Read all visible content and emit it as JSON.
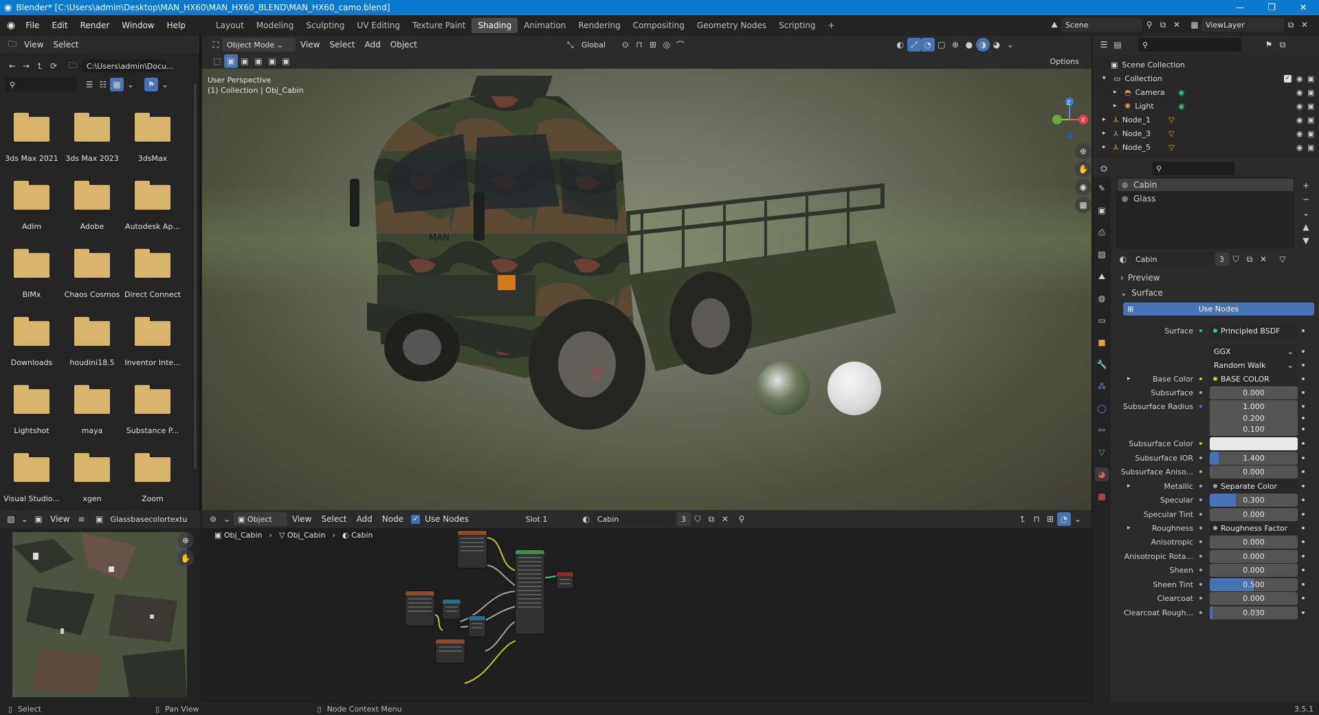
{
  "window": {
    "title": "Blender* [C:\\Users\\admin\\Desktop\\MAN_HX60\\MAN_HX60_BLEND\\MAN_HX60_camo.blend]",
    "minimize": "—",
    "maximize": "❐",
    "close": "✕"
  },
  "menu": {
    "items": [
      "File",
      "Edit",
      "Render",
      "Window",
      "Help"
    ]
  },
  "workspaces": [
    "Layout",
    "Modeling",
    "Sculpting",
    "UV Editing",
    "Texture Paint",
    "Shading",
    "Animation",
    "Rendering",
    "Compositing",
    "Geometry Nodes",
    "Scripting"
  ],
  "active_workspace": "Shading",
  "scene": {
    "name": "Scene",
    "view_layer": "ViewLayer"
  },
  "filebrowser": {
    "header": {
      "view": "View",
      "select": "Select"
    },
    "path": "C:\\Users\\admin\\Docu...",
    "folders": [
      "3ds Max 2021",
      "3ds Max 2023",
      "3dsMax",
      "Adlm",
      "Adobe",
      "Autodesk Ap...",
      "BIMx",
      "Chaos Cosmos",
      "Direct Connect",
      "Downloads",
      "houdini18.5",
      "Inventor Inte...",
      "Lightshot",
      "maya",
      "Substance P...",
      "Visual Studio...",
      "xgen",
      "Zoom"
    ]
  },
  "viewport": {
    "mode": "Object Mode",
    "menus": [
      "View",
      "Select",
      "Add",
      "Object"
    ],
    "transform": "Global",
    "options": "Options",
    "overlay_line1": "User Perspective",
    "overlay_line2": "(1) Collection | Obj_Cabin",
    "gizmo": {
      "z": "Z",
      "y": "Y",
      "x": "X"
    },
    "truck_brand": "MAN"
  },
  "outliner": {
    "root": "Scene Collection",
    "items": [
      {
        "name": "Collection",
        "level": 1
      },
      {
        "name": "Camera",
        "level": 2
      },
      {
        "name": "Light",
        "level": 2
      },
      {
        "name": "Node_1",
        "level": 1
      },
      {
        "name": "Node_3",
        "level": 1
      },
      {
        "name": "Node_5",
        "level": 1
      }
    ]
  },
  "material_slots": [
    "Cabin",
    "Glass"
  ],
  "material": {
    "name": "Cabin",
    "users": "3",
    "preview": "Preview",
    "surface_section": "Surface",
    "use_nodes": "Use Nodes"
  },
  "properties": [
    {
      "label": "Surface",
      "value": "Principled BSDF",
      "type": "link",
      "dot": "grn"
    },
    {
      "label": "",
      "value": "GGX",
      "type": "dropdown"
    },
    {
      "label": "",
      "value": "Random Walk",
      "type": "dropdown"
    },
    {
      "label": "Base Color",
      "value": "BASE COLOR",
      "type": "link",
      "dot": "yel",
      "expand": true
    },
    {
      "label": "Subsurface",
      "value": "0.000",
      "type": "num"
    },
    {
      "label": "Subsurface Radius",
      "value": "1.000",
      "type": "num",
      "dot": "blu"
    },
    {
      "label": "",
      "value": "0.200",
      "type": "num",
      "nodot": true
    },
    {
      "label": "",
      "value": "0.100",
      "type": "num",
      "nodot": true
    },
    {
      "label": "Subsurface Color",
      "value": "",
      "type": "color",
      "dot": "yel"
    },
    {
      "label": "Subsurface IOR",
      "value": "1.400",
      "type": "num",
      "fill": 0.1
    },
    {
      "label": "Subsurface Aniso...",
      "value": "0.000",
      "type": "num"
    },
    {
      "label": "Metallic",
      "value": "Separate Color",
      "type": "link",
      "expand": true
    },
    {
      "label": "Specular",
      "value": "0.300",
      "type": "num",
      "fill": 0.3
    },
    {
      "label": "Specular Tint",
      "value": "0.000",
      "type": "num"
    },
    {
      "label": "Roughness",
      "value": "Roughness Factor",
      "type": "link",
      "expand": true
    },
    {
      "label": "Anisotropic",
      "value": "0.000",
      "type": "num"
    },
    {
      "label": "Anisotropic Rota...",
      "value": "0.000",
      "type": "num"
    },
    {
      "label": "Sheen",
      "value": "0.000",
      "type": "num"
    },
    {
      "label": "Sheen Tint",
      "value": "0.500",
      "type": "num",
      "fill": 0.5
    },
    {
      "label": "Clearcoat",
      "value": "0.000",
      "type": "num"
    },
    {
      "label": "Clearcoat Rough...",
      "value": "0.030",
      "type": "num",
      "fill": 0.03
    }
  ],
  "image_editor": {
    "view": "View",
    "image_name": "Glassbasecolortextu"
  },
  "node_editor": {
    "object": "Object",
    "menus": [
      "View",
      "Select",
      "Add",
      "Node"
    ],
    "use_nodes": "Use Nodes",
    "slot": "Slot 1",
    "material": "Cabin",
    "users": "3",
    "breadcrumb": [
      "Obj_Cabin",
      "Obj_Cabin",
      "Cabin"
    ]
  },
  "statusbar": {
    "select": "Select",
    "pan": "Pan View",
    "context": "Node Context Menu",
    "version": "3.5.1"
  },
  "colors": {
    "accent": "#4772b3",
    "titlebar": "#0b79d0",
    "folder": "#d9b56b"
  }
}
